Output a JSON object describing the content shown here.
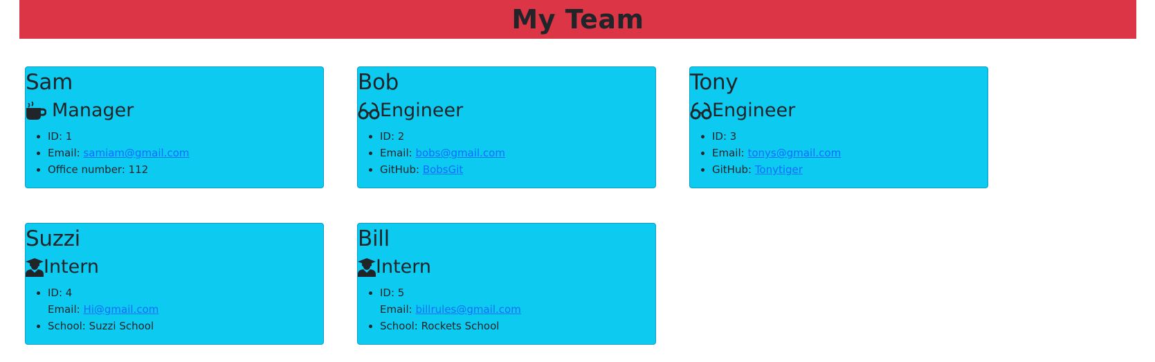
{
  "header": {
    "title": "My Team"
  },
  "colors": {
    "header_bg": "#dc3545",
    "card_bg": "#0dcaf0",
    "link": "#0d6efd"
  },
  "cards": [
    {
      "name": "Sam",
      "role": "Manager",
      "icon": "mug-icon",
      "id_label": "ID: 1",
      "email_prefix": "Email: ",
      "email": "samiam@gmail.com",
      "extra_prefix": "Office number: 112",
      "extra_link": ""
    },
    {
      "name": "Bob",
      "role": "Engineer",
      "icon": "glasses-icon",
      "id_label": "ID: 2",
      "email_prefix": "Email: ",
      "email": "bobs@gmail.com",
      "extra_prefix": "GitHub: ",
      "extra_link": "BobsGit"
    },
    {
      "name": "Tony",
      "role": "Engineer",
      "icon": "glasses-icon",
      "id_label": "ID: 3",
      "email_prefix": "Email: ",
      "email": "tonys@gmail.com",
      "extra_prefix": "GitHub: ",
      "extra_link": "Tonytiger"
    },
    {
      "name": "Suzzi",
      "role": "Intern",
      "icon": "graduate-icon",
      "id_label": "ID: 4",
      "email_prefix": "Email: ",
      "email": "Hi@gmail.com",
      "extra_prefix": "School: Suzzi School",
      "extra_link": ""
    },
    {
      "name": "Bill",
      "role": "Intern",
      "icon": "graduate-icon",
      "id_label": "ID: 5",
      "email_prefix": "Email: ",
      "email": "billrules@gmail.com",
      "extra_prefix": "School: Rockets School",
      "extra_link": ""
    }
  ]
}
